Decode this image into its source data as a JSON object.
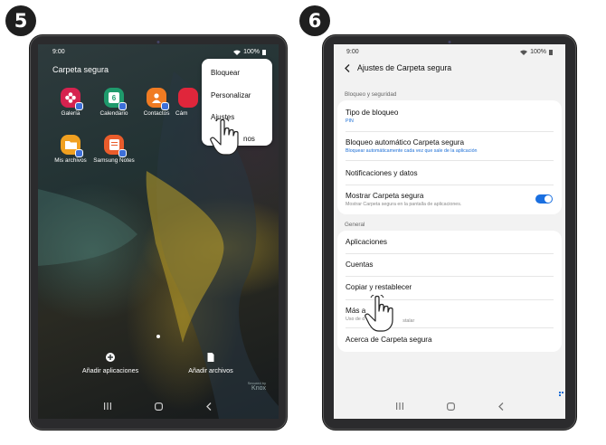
{
  "steps": {
    "left": "5",
    "right": "6"
  },
  "status": {
    "time": "9:00",
    "battery": "100%"
  },
  "left_screen": {
    "folder_title": "Carpeta segura",
    "apps": [
      {
        "label": "Galería",
        "icon": "gallery-icon",
        "color": "#d6224f"
      },
      {
        "label": "Calendario",
        "icon": "calendar-icon",
        "color": "#1f9a6c",
        "icon_text": "6"
      },
      {
        "label": "Contactos",
        "icon": "contacts-icon",
        "color": "#f07b22"
      },
      {
        "label": "Cám",
        "icon": "camera-icon",
        "color": "#e0263b"
      },
      {
        "label": "Mis archivos",
        "icon": "folder-icon",
        "color": "#f0a020"
      },
      {
        "label": "Samsung Notes",
        "icon": "notes-icon",
        "color": "#ea5c2b"
      }
    ],
    "menu": [
      "Bloquear",
      "Personalizar",
      "Ajustes",
      "nos"
    ],
    "bottom_actions": {
      "add_apps": "Añadir aplicaciones",
      "add_files": "Añadir archivos"
    },
    "watermark": {
      "small": "Secured by",
      "brand": "Knox"
    }
  },
  "right_screen": {
    "title": "Ajustes de Carpeta segura",
    "section_security": "Bloqueo y seguridad",
    "lock_type": {
      "title": "Tipo de bloqueo",
      "value": "PIN"
    },
    "auto_lock": {
      "title": "Bloqueo automático Carpeta segura",
      "value": "Bloquear automáticamente cada vez que sale de la aplicación"
    },
    "notifications": "Notificaciones y datos",
    "show_folder": {
      "title": "Mostrar Carpeta segura",
      "desc": "Mostrar Carpeta segura en la pantalla de aplicaciones.",
      "enabled": true
    },
    "section_general": "General",
    "general_items": [
      "Aplicaciones",
      "Cuentas",
      "Copiar y restablecer"
    ],
    "more": {
      "title": "Más a",
      "desc_start": "Uso de d",
      "desc_end": "stalar"
    },
    "about": "Acerca de Carpeta segura"
  },
  "colors": {
    "toggle_on": "#1a6fe0",
    "link_blue": "#1b6ed6",
    "badge": "#1f1f1f"
  }
}
